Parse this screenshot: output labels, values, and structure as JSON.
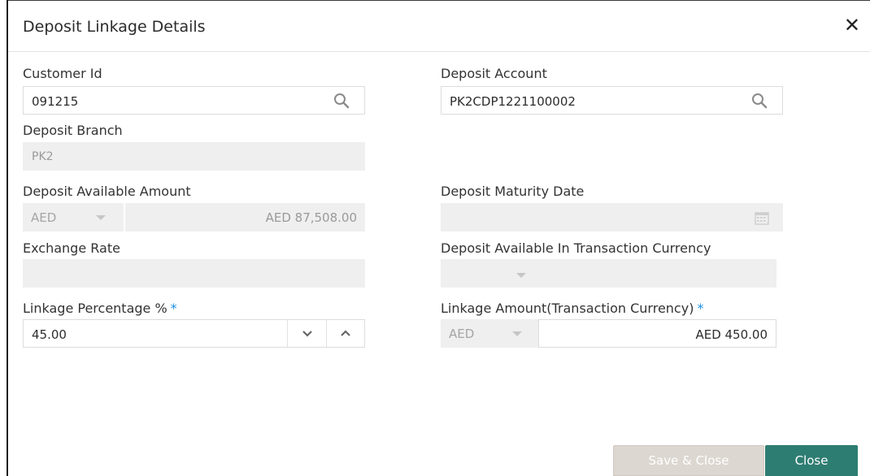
{
  "dialog": {
    "title": "Deposit Linkage Details"
  },
  "fields": {
    "customer_id": {
      "label": "Customer Id",
      "value": "091215"
    },
    "deposit_account": {
      "label": "Deposit Account",
      "value": "PK2CDP1221100002"
    },
    "deposit_branch": {
      "label": "Deposit Branch",
      "value": "PK2"
    },
    "deposit_available_amount": {
      "label": "Deposit Available Amount",
      "currency": "AED",
      "value": "AED 87,508.00"
    },
    "deposit_maturity_date": {
      "label": "Deposit Maturity Date",
      "value": ""
    },
    "exchange_rate": {
      "label": "Exchange Rate",
      "value": ""
    },
    "deposit_available_in_txn_currency": {
      "label": "Deposit Available In Transaction Currency",
      "value": ""
    },
    "linkage_percentage": {
      "label": "Linkage Percentage %",
      "required_mark": "*",
      "value": "45.00"
    },
    "linkage_amount": {
      "label": "Linkage Amount(Transaction Currency)",
      "required_mark": "*",
      "currency": "AED",
      "value": "AED 450.00"
    }
  },
  "buttons": {
    "save_close": "Save & Close",
    "close": "Close"
  },
  "icons": {
    "close": "close-icon",
    "search": "search-icon",
    "calendar": "calendar-icon",
    "chevron_down": "chevron-down-icon",
    "chevron_up": "chevron-up-icon"
  },
  "colors": {
    "accent": "#2e7d72",
    "required": "#1d8fe0",
    "readonly_bg": "#efefef"
  }
}
